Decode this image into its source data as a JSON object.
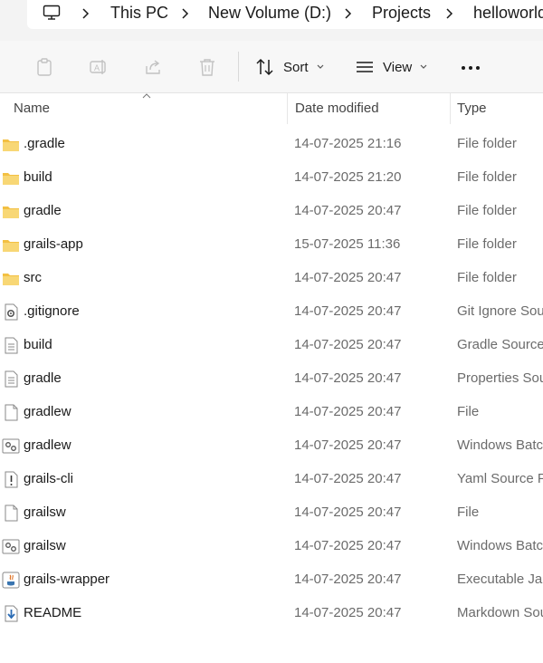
{
  "address_bar": {
    "crumbs": [
      "This PC",
      "New Volume (D:)",
      "Projects",
      "helloworld"
    ]
  },
  "command_bar": {
    "sort_label": "Sort",
    "view_label": "View"
  },
  "columns": {
    "name": "Name",
    "date": "Date modified",
    "type": "Type"
  },
  "files": [
    {
      "name": ".gradle",
      "date": "14-07-2025 21:16",
      "type": "File folder",
      "icon": "folder-icon"
    },
    {
      "name": "build",
      "date": "14-07-2025 21:20",
      "type": "File folder",
      "icon": "folder-icon"
    },
    {
      "name": "gradle",
      "date": "14-07-2025 20:47",
      "type": "File folder",
      "icon": "folder-icon"
    },
    {
      "name": "grails-app",
      "date": "15-07-2025 11:36",
      "type": "File folder",
      "icon": "folder-icon"
    },
    {
      "name": "src",
      "date": "14-07-2025 20:47",
      "type": "File folder",
      "icon": "folder-icon"
    },
    {
      "name": ".gitignore",
      "date": "14-07-2025 20:47",
      "type": "Git Ignore Source File",
      "icon": "gear-file-icon"
    },
    {
      "name": "build",
      "date": "14-07-2025 20:47",
      "type": "Gradle Source File",
      "icon": "text-file-icon"
    },
    {
      "name": "gradle",
      "date": "14-07-2025 20:47",
      "type": "Properties Source File",
      "icon": "text-file-icon"
    },
    {
      "name": "gradlew",
      "date": "14-07-2025 20:47",
      "type": "File",
      "icon": "blank-file-icon"
    },
    {
      "name": "gradlew",
      "date": "14-07-2025 20:47",
      "type": "Windows Batch File",
      "icon": "batch-file-icon"
    },
    {
      "name": "grails-cli",
      "date": "14-07-2025 20:47",
      "type": "Yaml Source File",
      "icon": "yaml-file-icon"
    },
    {
      "name": "grailsw",
      "date": "14-07-2025 20:47",
      "type": "File",
      "icon": "blank-file-icon"
    },
    {
      "name": "grailsw",
      "date": "14-07-2025 20:47",
      "type": "Windows Batch File",
      "icon": "batch-file-icon"
    },
    {
      "name": "grails-wrapper",
      "date": "14-07-2025 20:47",
      "type": "Executable Jar File",
      "icon": "jar-file-icon"
    },
    {
      "name": "README",
      "date": "14-07-2025 20:47",
      "type": "Markdown Source File",
      "icon": "markdown-file-icon"
    }
  ]
}
